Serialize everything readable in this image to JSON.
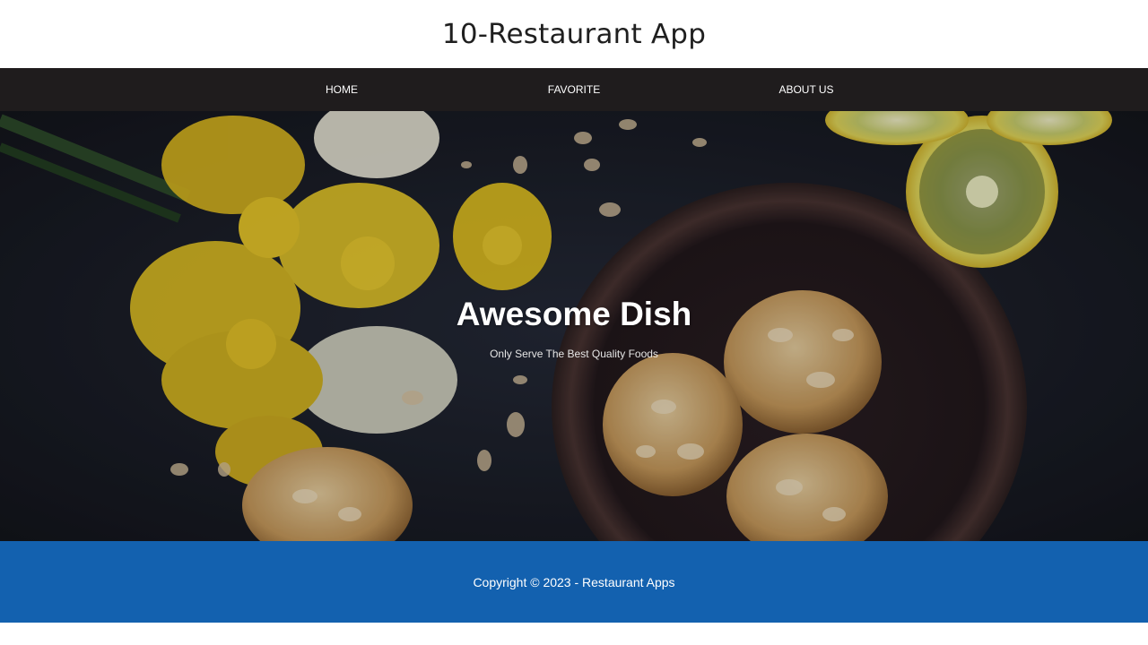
{
  "header": {
    "title": "10-Restaurant App"
  },
  "nav": {
    "items": [
      {
        "label": "HOME"
      },
      {
        "label": "FAVORITE"
      },
      {
        "label": "ABOUT US"
      }
    ]
  },
  "hero": {
    "title": "Awesome Dish",
    "tagline": "Only Serve The Best Quality Foods"
  },
  "footer": {
    "copyright": "Copyright © 2023 - Restaurant Apps"
  },
  "colors": {
    "nav_background": "#1f1c1d",
    "footer_background": "#1361af",
    "hero_background": "#1a1d27"
  }
}
